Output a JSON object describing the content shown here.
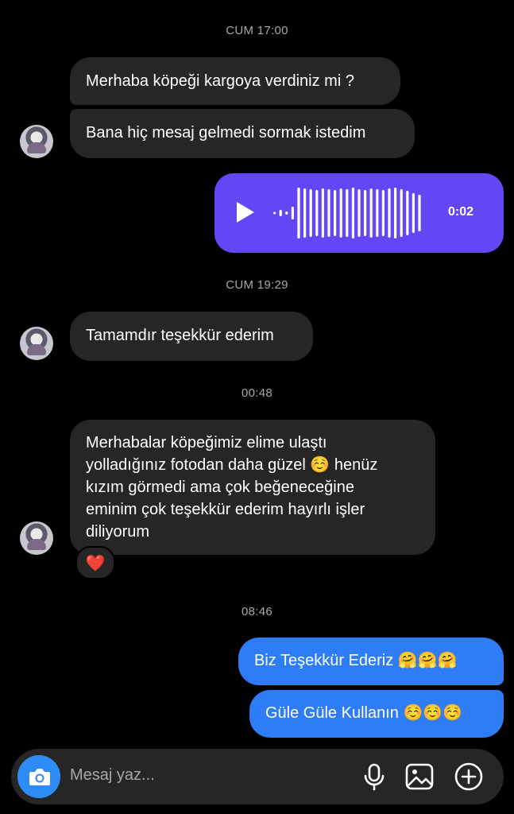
{
  "timestamps": [
    "CUM 17:00",
    "CUM 19:29",
    "00:48",
    "08:46"
  ],
  "messages": {
    "m1": "Merhaba köpeği kargoya verdiniz mi ?",
    "m2": "Bana hiç mesaj gelmedi sormak istedim",
    "m3": "Tamamdır teşekkür ederim",
    "m4_lines": [
      "Merhabalar köpeğimiz elime ulaştı",
      "yolladığınız fotodan daha güzel ☺️ henüz",
      "kızım görmedi ama çok beğeneceğine",
      "eminim çok teşekkür ederim hayırlı işler",
      "diliyorum"
    ],
    "m5": "Biz Teşekkür Ederiz 🤗🤗🤗",
    "m6": "Güle Güle Kullanın ☺️☺️☺️"
  },
  "voice": {
    "duration": "0:02",
    "color": "#6446f5"
  },
  "reaction": "❤️",
  "composer": {
    "placeholder": "Mesaj yaz..."
  },
  "icons": [
    "camera-icon",
    "microphone-icon",
    "gallery-icon",
    "add-circle-icon",
    "play-icon"
  ]
}
